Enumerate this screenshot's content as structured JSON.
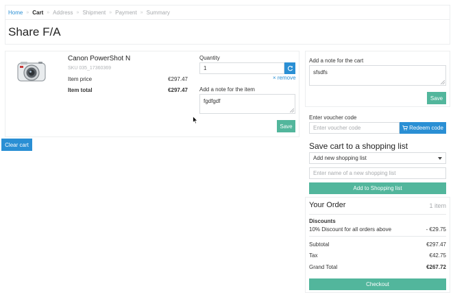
{
  "breadcrumb": {
    "home": "Home",
    "cart": "Cart",
    "address": "Address",
    "shipment": "Shipment",
    "payment": "Payment",
    "summary": "Summary",
    "separator": "»"
  },
  "page_title": "Share F/A",
  "item": {
    "name": "Canon PowerShot N",
    "sku": "SKU 035_17360369",
    "price_label": "Item price",
    "price": "€297.47",
    "total_label": "Item total",
    "total": "€297.47",
    "quantity_label": "Quantity",
    "quantity": "1",
    "remove": "× remove",
    "note_label": "Add a note for the item",
    "note_value": "fgdfgdf",
    "save": "Save"
  },
  "clear_cart": "Clear cart",
  "cart_note": {
    "label": "Add a note for the cart",
    "value": "sfsdfs",
    "save": "Save"
  },
  "voucher": {
    "label": "Enter voucher code",
    "placeholder": "Enter voucher code",
    "button": "Redeem code"
  },
  "shopping_list": {
    "title": "Save cart to a shopping list",
    "select_value": "Add new shopping list",
    "name_placeholder": "Enter name of a new shopping list",
    "add_button": "Add to Shopping list"
  },
  "order": {
    "title": "Your Order",
    "count": "1 item",
    "discounts_label": "Discounts",
    "discount_name": "10% Discount for all orders above",
    "discount_value": "- €29.75",
    "subtotal_label": "Subtotal",
    "subtotal": "€297.47",
    "tax_label": "Tax",
    "tax": "€42.75",
    "grand_total_label": "Grand Total",
    "grand_total": "€267.72",
    "checkout": "Checkout"
  },
  "colors": {
    "link_blue": "#2a8fd4",
    "button_green": "#52b69c"
  },
  "icons": [
    "refresh-icon",
    "resize-grip-icon",
    "chevron-down-icon",
    "cart-icon",
    "cursor-icon"
  ]
}
